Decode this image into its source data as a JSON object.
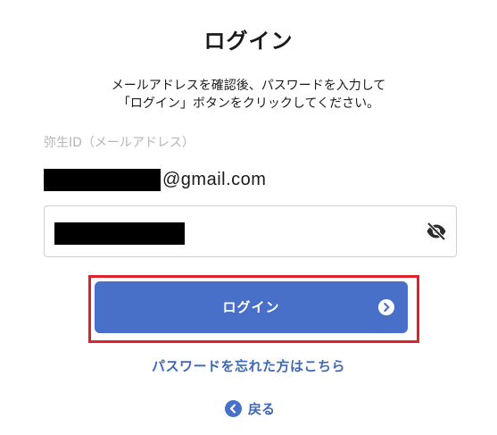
{
  "page": {
    "title": "ログイン",
    "instructions_line1": "メールアドレスを確認後、パスワードを入力して",
    "instructions_line2": "「ログイン」ボタンをクリックしてください。"
  },
  "id_field": {
    "label": "弥生ID（メールアドレス）",
    "value_visible_suffix": "@gmail.com"
  },
  "password_field": {
    "toggle_icon": "eye-slash-icon"
  },
  "login_button": {
    "label": "ログイン",
    "icon": "chevron-right-circle-icon"
  },
  "links": {
    "forgot_password": "パスワードを忘れた方はこちら",
    "back": "戻る",
    "back_icon": "chevron-left-circle-icon"
  },
  "colors": {
    "primary": "#4870c8",
    "link": "#3e68b6",
    "highlight": "#e0202a",
    "label_gray": "#b6b6b6"
  }
}
